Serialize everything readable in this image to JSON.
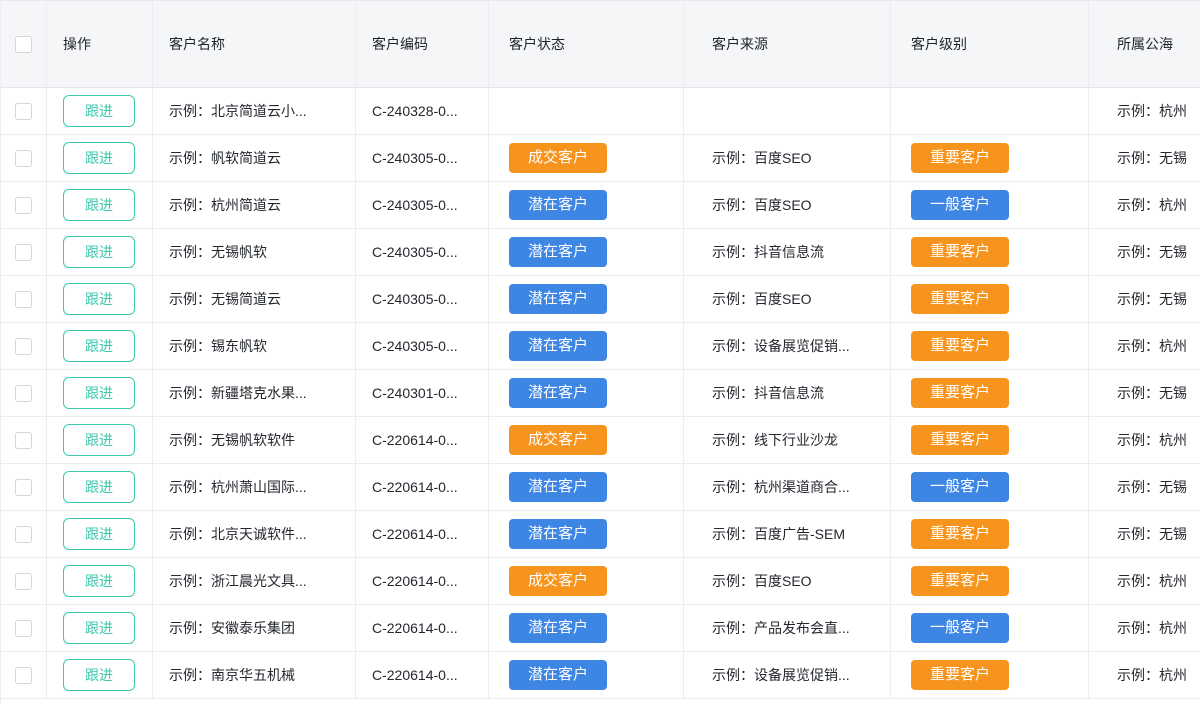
{
  "colors": {
    "orange": "#f7941d",
    "blue": "#3e86e4",
    "teal": "#3ec9ad",
    "header_bg": "#f5f6f8",
    "border": "#ebedf0"
  },
  "table": {
    "columns": [
      "操作",
      "客户名称",
      "客户编码",
      "客户状态",
      "客户来源",
      "客户级别",
      "所属公海"
    ],
    "follow_up_label": "跟进",
    "rows": [
      {
        "name": "示例：北京简道云小...",
        "code": "C-240328-0...",
        "status": null,
        "source": "",
        "level": null,
        "pool": "示例：杭州"
      },
      {
        "name": "示例：帆软简道云",
        "code": "C-240305-0...",
        "status": {
          "label": "成交客户",
          "color": "orange"
        },
        "source": "示例：百度SEO",
        "level": {
          "label": "重要客户",
          "color": "orange"
        },
        "pool": "示例：无锡"
      },
      {
        "name": "示例：杭州简道云",
        "code": "C-240305-0...",
        "status": {
          "label": "潜在客户",
          "color": "blue"
        },
        "source": "示例：百度SEO",
        "level": {
          "label": "一般客户",
          "color": "blue"
        },
        "pool": "示例：杭州"
      },
      {
        "name": "示例：无锡帆软",
        "code": "C-240305-0...",
        "status": {
          "label": "潜在客户",
          "color": "blue"
        },
        "source": "示例：抖音信息流",
        "level": {
          "label": "重要客户",
          "color": "orange"
        },
        "pool": "示例：无锡"
      },
      {
        "name": "示例：无锡简道云",
        "code": "C-240305-0...",
        "status": {
          "label": "潜在客户",
          "color": "blue"
        },
        "source": "示例：百度SEO",
        "level": {
          "label": "重要客户",
          "color": "orange"
        },
        "pool": "示例：无锡"
      },
      {
        "name": "示例：锡东帆软",
        "code": "C-240305-0...",
        "status": {
          "label": "潜在客户",
          "color": "blue"
        },
        "source": "示例：设备展览促销...",
        "level": {
          "label": "重要客户",
          "color": "orange"
        },
        "pool": "示例：杭州"
      },
      {
        "name": "示例：新疆塔克水果...",
        "code": "C-240301-0...",
        "status": {
          "label": "潜在客户",
          "color": "blue"
        },
        "source": "示例：抖音信息流",
        "level": {
          "label": "重要客户",
          "color": "orange"
        },
        "pool": "示例：无锡"
      },
      {
        "name": "示例：无锡帆软软件",
        "code": "C-220614-0...",
        "status": {
          "label": "成交客户",
          "color": "orange"
        },
        "source": "示例：线下行业沙龙",
        "level": {
          "label": "重要客户",
          "color": "orange"
        },
        "pool": "示例：杭州"
      },
      {
        "name": "示例：杭州萧山国际...",
        "code": "C-220614-0...",
        "status": {
          "label": "潜在客户",
          "color": "blue"
        },
        "source": "示例：杭州渠道商合...",
        "level": {
          "label": "一般客户",
          "color": "blue"
        },
        "pool": "示例：无锡"
      },
      {
        "name": "示例：北京天诚软件...",
        "code": "C-220614-0...",
        "status": {
          "label": "潜在客户",
          "color": "blue"
        },
        "source": "示例：百度广告-SEM",
        "level": {
          "label": "重要客户",
          "color": "orange"
        },
        "pool": "示例：无锡"
      },
      {
        "name": "示例：浙江晨光文具...",
        "code": "C-220614-0...",
        "status": {
          "label": "成交客户",
          "color": "orange"
        },
        "source": "示例：百度SEO",
        "level": {
          "label": "重要客户",
          "color": "orange"
        },
        "pool": "示例：杭州"
      },
      {
        "name": "示例：安徽泰乐集团",
        "code": "C-220614-0...",
        "status": {
          "label": "潜在客户",
          "color": "blue"
        },
        "source": "示例：产品发布会直...",
        "level": {
          "label": "一般客户",
          "color": "blue"
        },
        "pool": "示例：杭州"
      },
      {
        "name": "示例：南京华五机械",
        "code": "C-220614-0...",
        "status": {
          "label": "潜在客户",
          "color": "blue"
        },
        "source": "示例：设备展览促销...",
        "level": {
          "label": "重要客户",
          "color": "orange"
        },
        "pool": "示例：杭州"
      }
    ]
  }
}
